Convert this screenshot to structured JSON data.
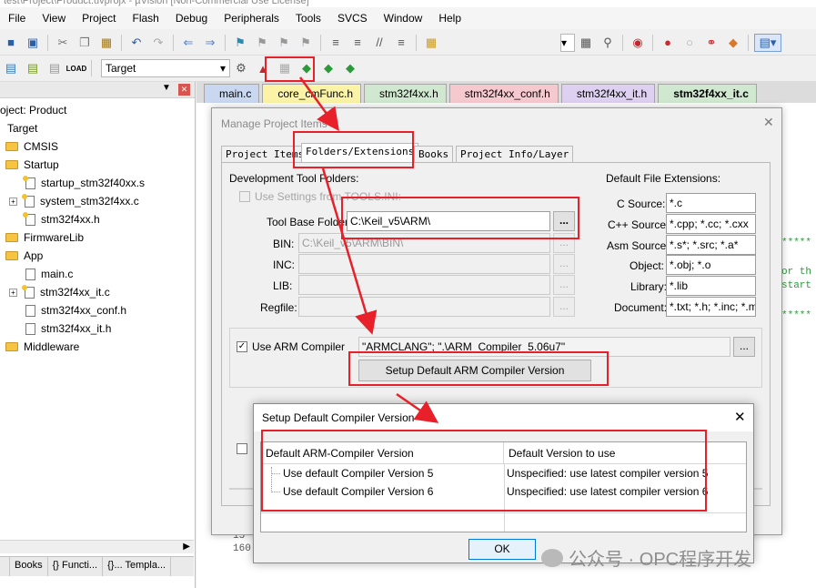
{
  "window": {
    "title": "test\\Project\\Product.uvprojx - µVision  [Non-Commercial Use License]"
  },
  "menu": [
    "File",
    "View",
    "Project",
    "Flash",
    "Debug",
    "Peripherals",
    "Tools",
    "SVCS",
    "Window",
    "Help"
  ],
  "toolbar2": {
    "target": "Target"
  },
  "project_panel": {
    "tree": [
      {
        "label": "oject: Product",
        "kind": "root"
      },
      {
        "label": "Target",
        "kind": "target"
      },
      {
        "label": "CMSIS",
        "kind": "folder"
      },
      {
        "label": "Startup",
        "kind": "folder"
      },
      {
        "label": "startup_stm32f40xx.s",
        "kind": "file"
      },
      {
        "label": "system_stm32f4xx.c",
        "kind": "file"
      },
      {
        "label": "stm32f4xx.h",
        "kind": "file"
      },
      {
        "label": "FirmwareLib",
        "kind": "folder"
      },
      {
        "label": "App",
        "kind": "folder"
      },
      {
        "label": "main.c",
        "kind": "file"
      },
      {
        "label": "stm32f4xx_it.c",
        "kind": "file"
      },
      {
        "label": "stm32f4xx_conf.h",
        "kind": "file"
      },
      {
        "label": "stm32f4xx_it.h",
        "kind": "file"
      },
      {
        "label": "Middleware",
        "kind": "folder"
      }
    ],
    "tabs": [
      "Books",
      "{} Functi...",
      "{}... Templa..."
    ]
  },
  "editor": {
    "tabs": [
      {
        "label": "main.c",
        "color": "#c9d8f0"
      },
      {
        "label": "core_cmFunc.h",
        "color": "#fbf3a5"
      },
      {
        "label": "stm32f4xx.h",
        "color": "#cfe8cf"
      },
      {
        "label": "stm32f4xx_conf.h",
        "color": "#f6c9cf"
      },
      {
        "label": "stm32f4xx_it.h",
        "color": "#ddd0f0"
      },
      {
        "label": "stm32f4xx_it.c",
        "color": "#cfe8cf"
      }
    ],
    "code": [
      "*****",
      "or th",
      "start",
      "*****",
      "15",
      "160"
    ]
  },
  "manage_dialog": {
    "title": "Manage Project Items",
    "tabs": [
      "Project Items",
      "Folders/Extensions",
      "Books",
      "Project Info/Layer"
    ],
    "dev_tool_folders": "Development Tool Folders:",
    "use_settings": "Use Settings from TOOLS.INI:",
    "tool_base_label": "Tool Base Folder:",
    "tool_base_value": "C:\\Keil_v5\\ARM\\",
    "bin_label": "BIN:",
    "bin_value": "C:\\Keil_v5\\ARM\\BIN\\",
    "inc_label": "INC:",
    "lib_label": "LIB:",
    "regfile_label": "Regfile:",
    "browse": "...",
    "default_ext_title": "Default File Extensions:",
    "extensions": [
      {
        "label": "C Source:",
        "value": "*.c"
      },
      {
        "label": "C++ Source:",
        "value": "*.cpp; *.cc; *.cxx"
      },
      {
        "label": "Asm Source:",
        "value": "*.s*; *.src; *.a*"
      },
      {
        "label": "Object:",
        "value": "*.obj; *.o"
      },
      {
        "label": "Library:",
        "value": "*.lib"
      },
      {
        "label": "Document:",
        "value": "*.txt; *.h; *.inc; *.md"
      }
    ],
    "use_arm_compiler": "Use ARM Compiler",
    "compiler_value": "\"ARMCLANG\"; \".\\ARM_Compiler_5.06u7\"",
    "setup_default_btn": "Setup Default ARM Compiler Version"
  },
  "setup_dialog": {
    "title": "Setup Default Compiler Version",
    "col1": "Default ARM-Compiler Version",
    "col2": "Default Version to use",
    "rows": [
      {
        "name": "Use default Compiler Version 5",
        "value": "Unspecified: use latest compiler version 5"
      },
      {
        "name": "Use default Compiler Version 6",
        "value": "Unspecified: use latest compiler version 6"
      }
    ],
    "ok": "OK"
  },
  "watermark": "公众号 · OPC程序开发",
  "colors": {
    "annotation_red": "#e8202a"
  }
}
